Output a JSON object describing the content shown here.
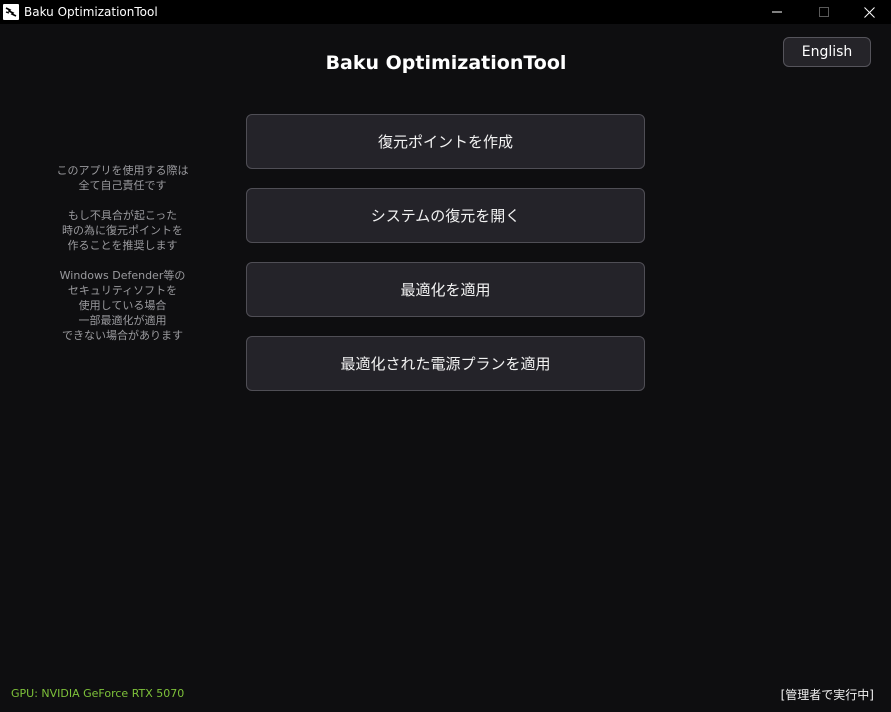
{
  "window": {
    "title": "Baku OptimizationTool",
    "icon": "app-icon",
    "controls": [
      "minimize-icon",
      "maximize-icon",
      "close-icon"
    ]
  },
  "header": {
    "title": "Baku OptimizationTool",
    "language_button": "English"
  },
  "note": {
    "lines": [
      "このアプリを使用する際は",
      "全て自己責任です",
      "",
      "もし不具合が起こった",
      "時の為に復元ポイントを",
      "作ることを推奨します",
      "",
      "Windows Defender等の",
      "セキュリティソフトを",
      "使用している場合",
      "一部最適化が適用",
      "できない場合があります"
    ]
  },
  "actions": [
    {
      "label": "復元ポイントを作成"
    },
    {
      "label": "システムの復元を開く"
    },
    {
      "label": "最適化を適用"
    },
    {
      "label": "最適化された電源プランを適用"
    }
  ],
  "footer": {
    "gpu": "GPU: NVIDIA GeForce RTX 5070",
    "admin_status": "[管理者で実行中]"
  },
  "colors": {
    "background": "#0e0e10",
    "button_bg": "#242329",
    "button_border": "#4f4e55",
    "gpu_text": "#7ec23a",
    "note_text": "#9a9a9e"
  }
}
